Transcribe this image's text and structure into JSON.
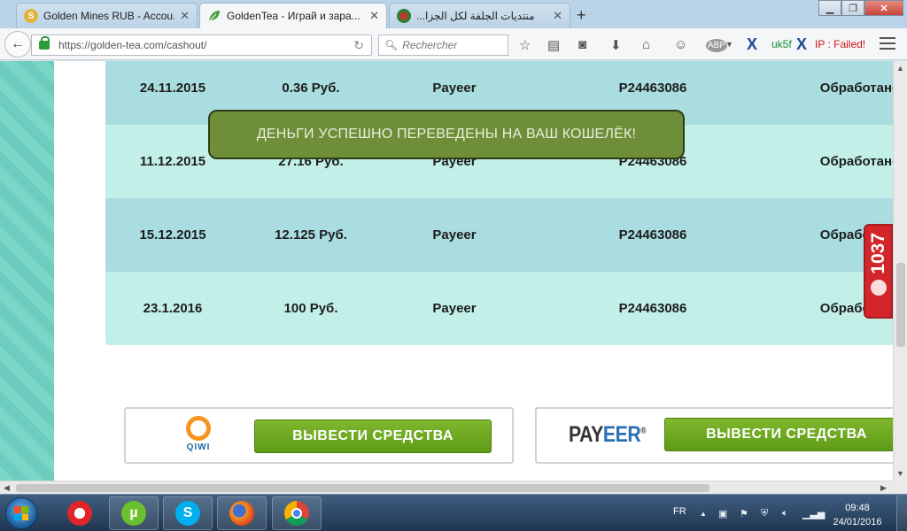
{
  "browser": {
    "tabs": [
      {
        "title": "Golden Mines RUB - Accou...",
        "favicon_color": "#e0b33a",
        "favicon_glyph": "S"
      },
      {
        "title": "GoldenTea - Играй и зара...",
        "favicon_color": "#4aa03a",
        "favicon_glyph": "leaf"
      },
      {
        "title": "...منتديات الجلفة لكل الجزا",
        "favicon_color": "#c0392b",
        "favicon_glyph": "flag"
      }
    ],
    "active_tab_index": 1,
    "url": "https://golden-tea.com/cashout/",
    "search_placeholder": "Rechercher",
    "toolbar_status": "uk5f",
    "ip_status": "IP : Failed!"
  },
  "payments": {
    "rows": [
      {
        "date": "24.11.2015",
        "amount": "0.36 Руб.",
        "system": "Payeer",
        "wallet": "P24463086",
        "status": "Обработано"
      },
      {
        "date": "11.12.2015",
        "amount": "27.16 Руб.",
        "system": "Payeer",
        "wallet": "P24463086",
        "status": "Обработано"
      },
      {
        "date": "15.12.2015",
        "amount": "12.125 Руб.",
        "system": "Payeer",
        "wallet": "P24463086",
        "status": "Обработано"
      },
      {
        "date": "23.1.2016",
        "amount": "100 Руб.",
        "system": "Payeer",
        "wallet": "P24463086",
        "status": "Обработано"
      }
    ]
  },
  "notification": "ДЕНЬГИ УСПЕШНО ПЕРЕВЕДЕНЫ НА ВАШ КОШЕЛЁК!",
  "withdraw": {
    "qiwi_logo_text": "QIWI",
    "payeer_logo_a": "PAY",
    "payeer_logo_b": "EER",
    "button_label": "ВЫВЕСТИ СРЕДСТВА"
  },
  "side_counter": "1037",
  "taskbar": {
    "language": "FR",
    "time": "09:48",
    "date": "24/01/2016"
  },
  "colors": {
    "row_dark": "#a9dde0",
    "row_light": "#c2f0e8",
    "toast_bg": "#6f8e3a",
    "button_green": "#6faa22",
    "counter_red": "#d3262a"
  }
}
